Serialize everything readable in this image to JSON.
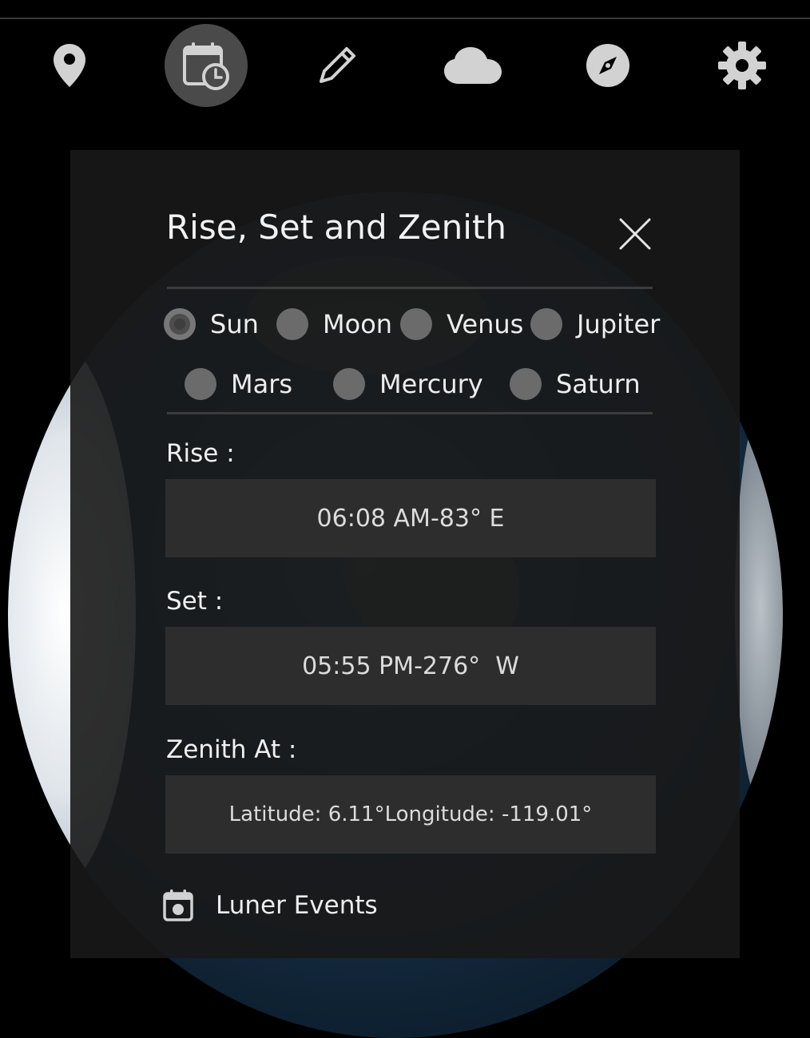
{
  "toolbar": {
    "items": [
      {
        "icon": "location-pin-icon",
        "active": false
      },
      {
        "icon": "calendar-clock-icon",
        "active": true
      },
      {
        "icon": "pencil-icon",
        "active": false
      },
      {
        "icon": "cloud-icon",
        "active": false
      },
      {
        "icon": "compass-icon",
        "active": false
      },
      {
        "icon": "gear-icon",
        "active": false
      }
    ]
  },
  "dialog": {
    "title": "Rise, Set and Zenith",
    "bodies": [
      {
        "label": "Sun",
        "selected": true
      },
      {
        "label": "Moon",
        "selected": false
      },
      {
        "label": "Venus",
        "selected": false
      },
      {
        "label": "Jupiter",
        "selected": false
      },
      {
        "label": "Mars",
        "selected": false
      },
      {
        "label": "Mercury",
        "selected": false
      },
      {
        "label": "Saturn",
        "selected": false
      }
    ],
    "rise": {
      "label": "Rise :",
      "time": "06:08 AM",
      "sep": "-",
      "azimuth": "83° E"
    },
    "set": {
      "label": "Set :",
      "time": "05:55 PM",
      "sep": "-",
      "azimuth": "276°  W"
    },
    "zenith": {
      "label": "Zenith At :",
      "latitude": "Latitude: 6.11°",
      "longitude": "Longitude: -119.01°"
    },
    "events_label": "Luner Events"
  },
  "colors": {
    "panel": "#181818",
    "value_box": "#2d2d2d",
    "active_tool": "#4a4a4a",
    "icon": "#cfcfcf"
  }
}
